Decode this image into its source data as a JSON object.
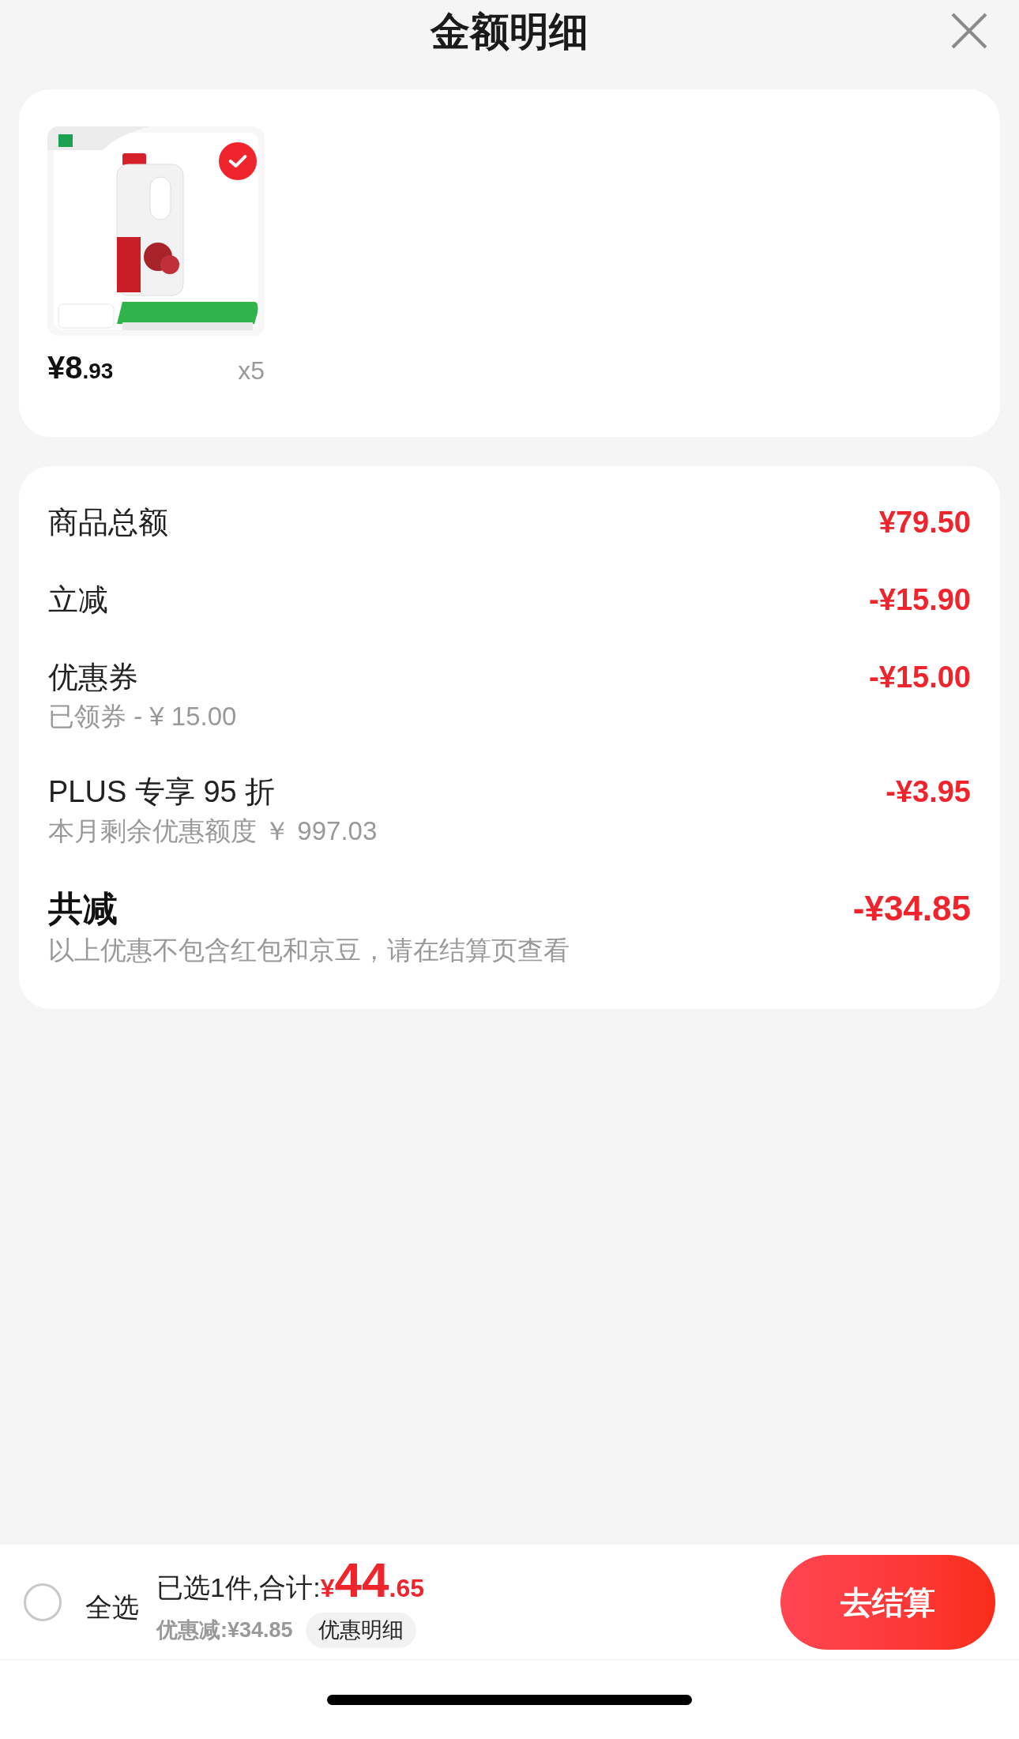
{
  "header": {
    "title": "金额明细"
  },
  "product": {
    "selected": true,
    "price_main": "¥8",
    "price_decimal": ".93",
    "quantity": "x5"
  },
  "breakdown": [
    {
      "kind": "normal",
      "label": "商品总额",
      "amount": "¥79.50"
    },
    {
      "kind": "normal",
      "label": "立减",
      "amount": "-¥15.90"
    },
    {
      "kind": "normal",
      "label": "优惠券",
      "amount": "-¥15.00",
      "note": "已领券 - ¥ 15.00"
    },
    {
      "kind": "normal",
      "label": "PLUS 专享 95 折",
      "amount": "-¥3.95",
      "note": "本月剩余优惠额度 ￥ 997.03"
    },
    {
      "kind": "total",
      "label": "共减",
      "amount": "-¥34.85",
      "note": "以上优惠不包含红包和京豆，请在结算页查看"
    }
  ],
  "bottom_bar": {
    "select_all": {
      "label": "全选",
      "checked": false
    },
    "selected_text": "已选1件,合计:",
    "total_currency": "¥",
    "total_main": "44",
    "total_decimal": ".65",
    "discount": "优惠减:¥34.85",
    "detail_button": "优惠明细",
    "checkout_button": "去结算"
  }
}
